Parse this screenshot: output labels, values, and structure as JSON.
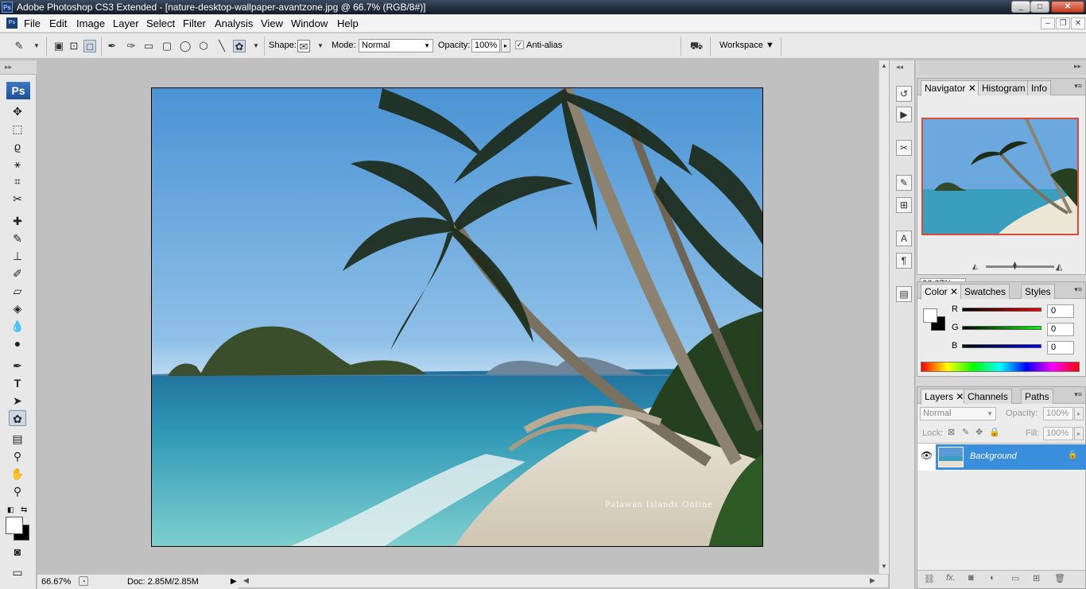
{
  "window": {
    "title": "Adobe Photoshop CS3 Extended - [nature-desktop-wallpaper-avantzone.jpg @ 66.7% (RGB/8#)]"
  },
  "menu": {
    "items": [
      "File",
      "Edit",
      "Image",
      "Layer",
      "Select",
      "Filter",
      "Analysis",
      "View",
      "Window",
      "Help"
    ]
  },
  "options": {
    "shape_label": "Shape:",
    "mode_label": "Mode:",
    "mode_value": "Normal",
    "opacity_label": "Opacity:",
    "opacity_value": "100%",
    "antialias_label": "Anti-alias",
    "antialias_checked": true,
    "workspace_label": "Workspace"
  },
  "toolbox": {
    "logo": "Ps"
  },
  "canvas": {
    "watermark": "Palawan Islands Online",
    "photo_colors": {
      "sky_top": "#4b95d6",
      "sea": "#3c9fc0",
      "sand": "#e9e3d3"
    }
  },
  "status": {
    "zoom": "66.67%",
    "doc": "Doc: 2.85M/2.85M"
  },
  "navigator": {
    "tabs": [
      "Navigator",
      "Histogram",
      "Info"
    ],
    "zoom": "66.67%",
    "frame_color": "#d84b3b"
  },
  "color": {
    "tabs": [
      "Color",
      "Swatches",
      "Styles"
    ],
    "channels": [
      {
        "label": "R",
        "value": "0"
      },
      {
        "label": "G",
        "value": "0"
      },
      {
        "label": "B",
        "value": "0"
      }
    ]
  },
  "layers": {
    "tabs": [
      "Layers",
      "Channels",
      "Paths"
    ],
    "blend_mode": "Normal",
    "opacity_label": "Opacity:",
    "opacity_value": "100%",
    "lock_label": "Lock:",
    "fill_label": "Fill:",
    "fill_value": "100%",
    "items": [
      {
        "name": "Background",
        "locked": true,
        "visible": true
      }
    ]
  }
}
